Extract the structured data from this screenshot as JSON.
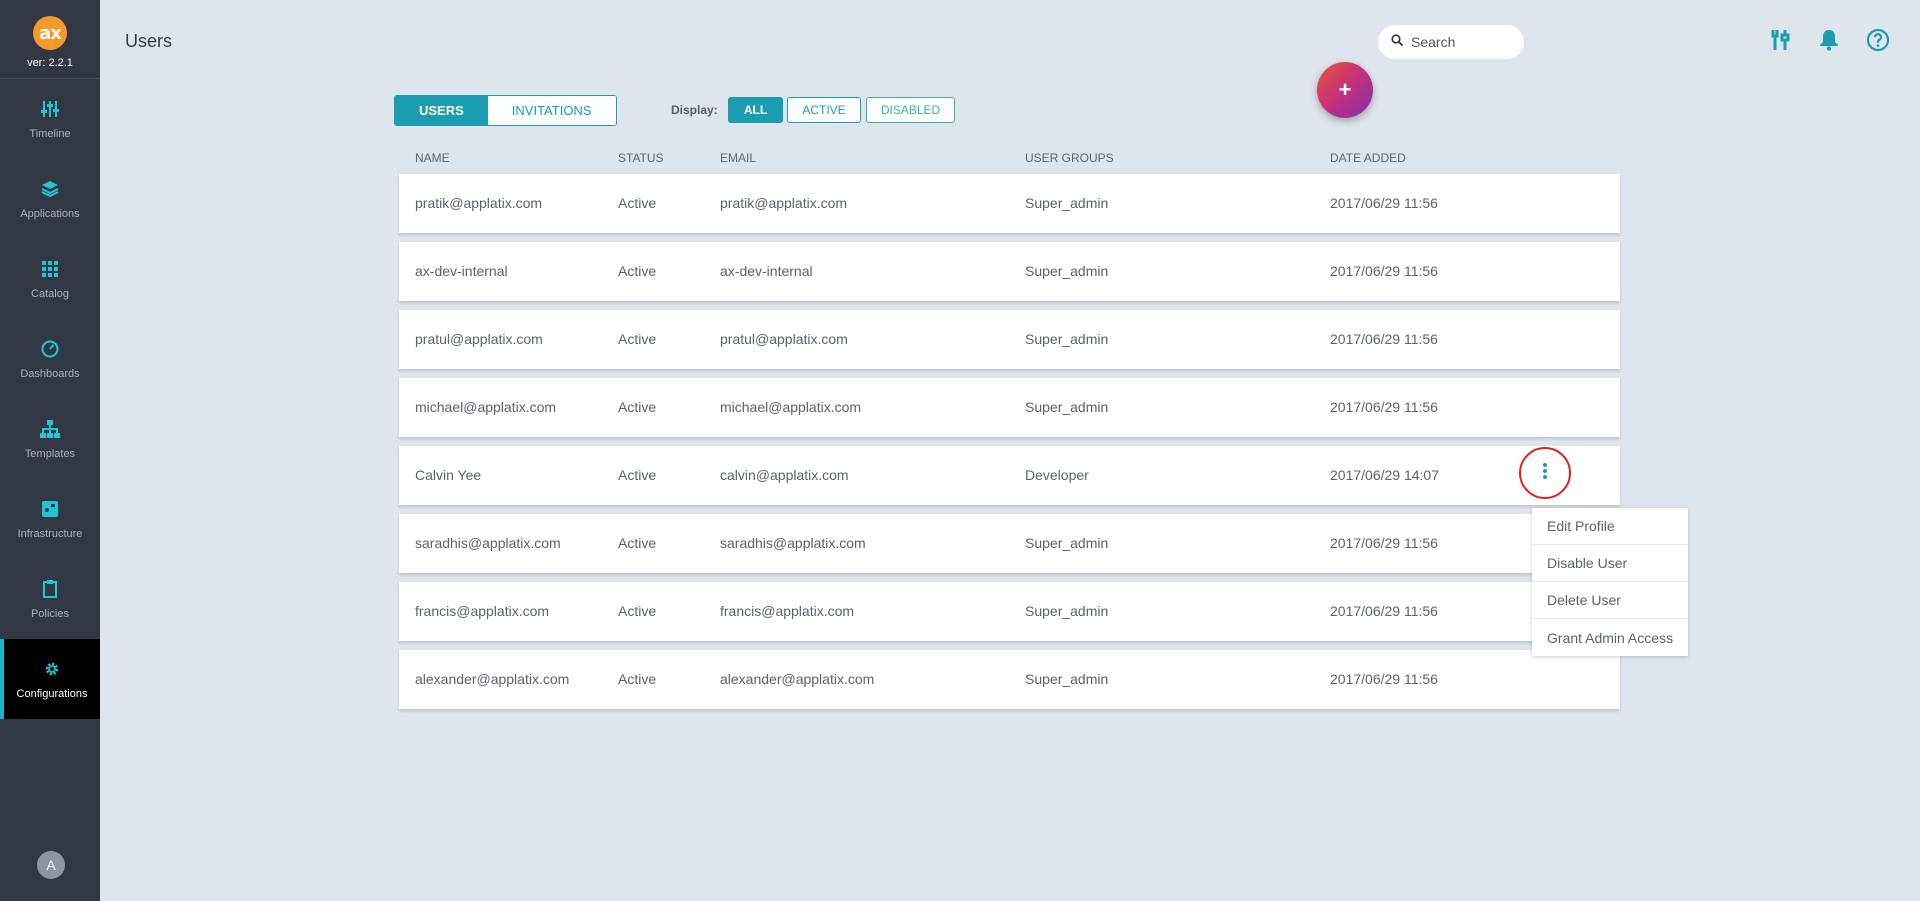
{
  "app": {
    "version": "ver: 2.2.1",
    "logo_text": "ax"
  },
  "sidebar": {
    "items": [
      {
        "label": "Timeline",
        "icon": "sliders-icon"
      },
      {
        "label": "Applications",
        "icon": "layers-icon"
      },
      {
        "label": "Catalog",
        "icon": "grid-icon"
      },
      {
        "label": "Dashboards",
        "icon": "gauge-icon"
      },
      {
        "label": "Templates",
        "icon": "hierarchy-icon"
      },
      {
        "label": "Infrastructure",
        "icon": "server-icon"
      },
      {
        "label": "Policies",
        "icon": "clipboard-icon"
      },
      {
        "label": "Configurations",
        "icon": "gear-icon",
        "active": true
      }
    ],
    "avatar": "A"
  },
  "header": {
    "title": "Users",
    "search_placeholder": "Search",
    "fab_label": "+"
  },
  "tabs": [
    {
      "label": "USERS",
      "active": true
    },
    {
      "label": "INVITATIONS",
      "active": false
    }
  ],
  "filters": {
    "label": "Display:",
    "options": [
      {
        "label": "ALL",
        "active": true
      },
      {
        "label": "ACTIVE",
        "active": false
      },
      {
        "label": "DISABLED",
        "active": false
      }
    ]
  },
  "table": {
    "headers": [
      "NAME",
      "STATUS",
      "EMAIL",
      "USER GROUPS",
      "DATE ADDED"
    ],
    "rows": [
      [
        "pratik@applatix.com",
        "Active",
        "pratik@applatix.com",
        "Super_admin",
        "2017/06/29 11:56"
      ],
      [
        "ax-dev-internal",
        "Active",
        "ax-dev-internal",
        "Super_admin",
        "2017/06/29 11:56"
      ],
      [
        "pratul@applatix.com",
        "Active",
        "pratul@applatix.com",
        "Super_admin",
        "2017/06/29 11:56"
      ],
      [
        "michael@applatix.com",
        "Active",
        "michael@applatix.com",
        "Super_admin",
        "2017/06/29 11:56"
      ],
      [
        "Calvin Yee",
        "Active",
        "calvin@applatix.com",
        "Developer",
        "2017/06/29 14:07"
      ],
      [
        "saradhis@applatix.com",
        "Active",
        "saradhis@applatix.com",
        "Super_admin",
        "2017/06/29 11:56"
      ],
      [
        "francis@applatix.com",
        "Active",
        "francis@applatix.com",
        "Super_admin",
        "2017/06/29 11:56"
      ],
      [
        "alexander@applatix.com",
        "Active",
        "alexander@applatix.com",
        "Super_admin",
        "2017/06/29 11:56"
      ]
    ]
  },
  "context_menu": {
    "items": [
      "Edit Profile",
      "Disable User",
      "Delete User",
      "Grant Admin Access"
    ]
  },
  "colors": {
    "accent": "#1a9db0",
    "sidebar": "#323843",
    "highlight_ring": "#e02020"
  }
}
